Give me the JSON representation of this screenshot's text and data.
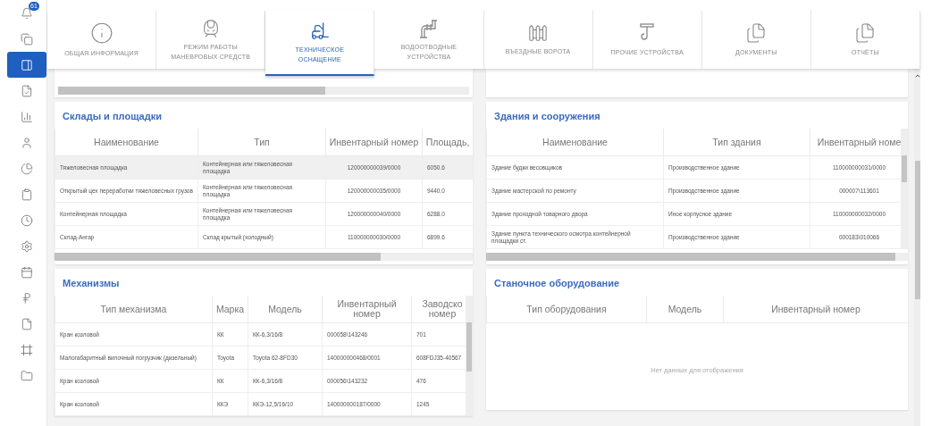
{
  "sidebar": {
    "items": [
      {
        "selected": false,
        "badge": "61"
      },
      {
        "selected": false
      },
      {
        "selected": true
      },
      {
        "selected": false
      },
      {
        "selected": false
      },
      {
        "selected": false
      },
      {
        "selected": false
      },
      {
        "selected": false
      },
      {
        "selected": false
      },
      {
        "selected": false
      },
      {
        "selected": false
      },
      {
        "selected": false
      },
      {
        "selected": false
      },
      {
        "selected": false
      },
      {
        "selected": false
      }
    ]
  },
  "tabs": [
    {
      "label": "ОБЩАЯ ИНФОРМАЦИЯ",
      "selected": false
    },
    {
      "label": "РЕЖИМ РАБОТЫ МАНЕВРОВЫХ СРЕДСТВ",
      "selected": false
    },
    {
      "label": "ТЕХНИЧЕСКОЕ ОСНАЩЕНИЕ",
      "selected": true
    },
    {
      "label": "ВОДООТВОДНЫЕ УСТРОЙСТВА",
      "selected": false
    },
    {
      "label": "ВЪЕЗДНЫЕ ВОРОТА",
      "selected": false
    },
    {
      "label": "ПРОЧИЕ УСТРОЙСТВА",
      "selected": false
    },
    {
      "label": "ДОКУМЕНТЫ",
      "selected": false
    },
    {
      "label": "ОТЧЁТЫ",
      "selected": false
    }
  ],
  "columns": [
    {
      "sections": [
        {
          "title": "Склады и площадки",
          "columns": [
            "Наименование",
            "Тип",
            "Инвентарный номер",
            "Площадь,"
          ],
          "rows": [
            {
              "selected": true,
              "cells": [
                "Тяжеловесная площадка",
                "Контейнерная или тяжеловесная площадка",
                "120000000039/0000",
                "6050.6"
              ]
            },
            {
              "selected": false,
              "cells": [
                "Открытый цех переработки тяжеловесных грузов",
                "Контейнерная или тяжеловесная площадка",
                "120000000035/0000",
                "9440.0"
              ]
            },
            {
              "selected": false,
              "cells": [
                "Контейнерная площадка",
                "Контейнерная или тяжеловесная площадка",
                "120000000040/0000",
                "6288.0"
              ]
            },
            {
              "selected": false,
              "cells": [
                "Склад-Ангар",
                "Склад крытый (холодный)",
                "110000000030/0000",
                "6899.6"
              ]
            }
          ]
        },
        {
          "title": "Механизмы",
          "columns": [
            "Тип механизма",
            "Марка",
            "Модель",
            "Инвентарный номер",
            "Заводско номер"
          ],
          "rows": [
            {
              "cells": [
                "Кран козловой",
                "КК",
                "КК-6,3/16/8",
                "000058\\143246",
                "701"
              ]
            },
            {
              "cells": [
                "Малогабаритный вилочный погрузчик (дизельный)",
                "Toyota",
                "Toyota 62-8FD30",
                "140000000468/0001",
                "608FDJ35-40567"
              ]
            },
            {
              "cells": [
                "Кран козловой",
                "КК",
                "КК-6,3/16/8",
                "000056\\143232",
                "476"
              ]
            },
            {
              "cells": [
                "Кран козловой",
                "ККЭ",
                "ККЭ-12,5/16/10",
                "140000000187/0000",
                "1245"
              ]
            }
          ]
        }
      ]
    },
    {
      "sections": [
        {
          "title": "Здания и сооружения",
          "columns": [
            "Наименование",
            "Тип здания",
            "Инвентарный номе"
          ],
          "rows": [
            {
              "cells": [
                "Здание будки весовщиков",
                "Производственное здание",
                "110000000031/0000"
              ]
            },
            {
              "cells": [
                "Здание мастерской по ремонту",
                "Производственное здание",
                "000007\\113601"
              ]
            },
            {
              "cells": [
                "Здание проходной товарного двора",
                "Иное корпусное здание",
                "110000000032/0000"
              ]
            },
            {
              "cells": [
                "Здание пункта технического осмотра контейнерной площадки ст.",
                "Производственное здание",
                "000183\\010066"
              ]
            }
          ]
        },
        {
          "title": "Станочное оборудование",
          "columns": [
            "Тип оборудования",
            "Модель",
            "Инвентарный номер"
          ],
          "empty": "Нет данных для отображения"
        }
      ]
    }
  ]
}
